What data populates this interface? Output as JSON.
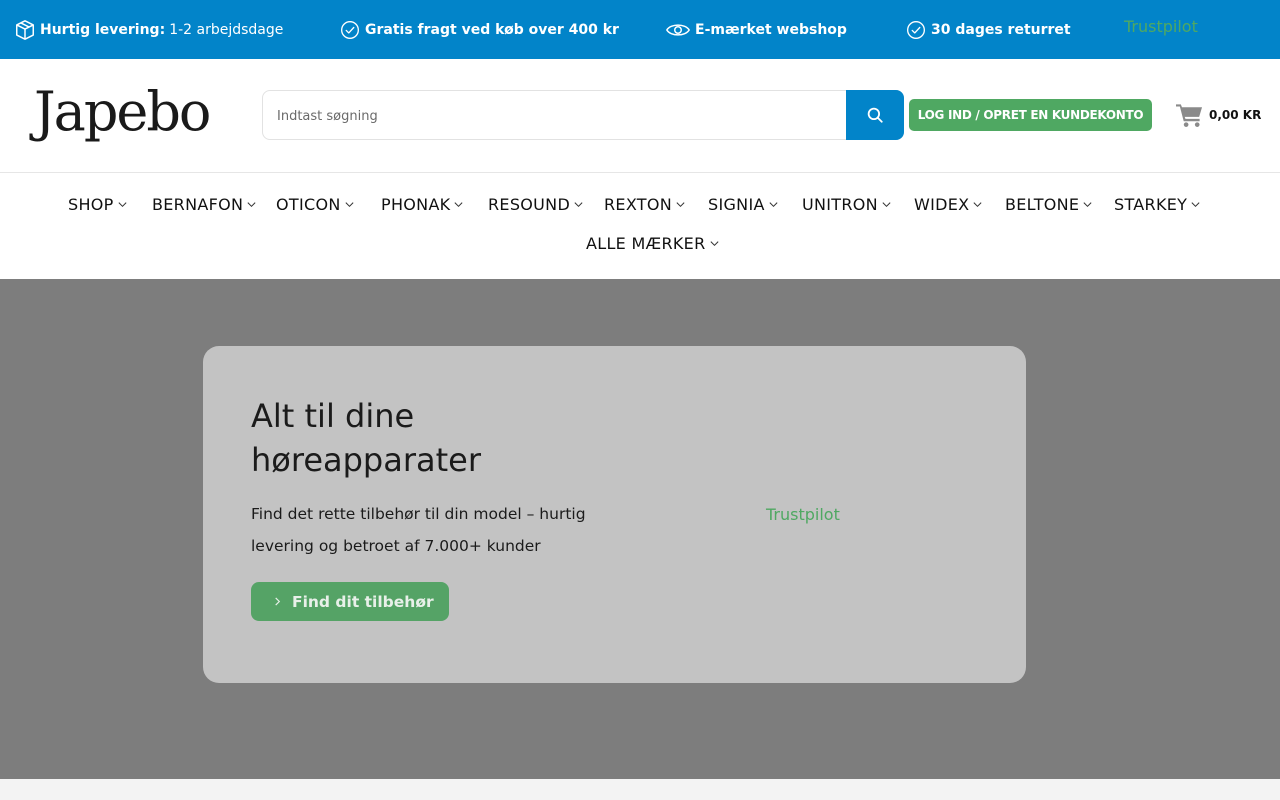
{
  "topbar": {
    "usps": [
      {
        "icon": "package-icon",
        "bold": "Hurtig levering:",
        "text": "1-2 arbejdsdage"
      },
      {
        "icon": "check-circle-icon",
        "bold": "Gratis fragt ved køb over 400 kr",
        "text": ""
      },
      {
        "icon": "eye-icon",
        "bold": "E-mærket webshop",
        "text": ""
      },
      {
        "icon": "check-circle-icon",
        "bold": "30 dages returret",
        "text": ""
      }
    ],
    "trustpilot": "Trustpilot"
  },
  "header": {
    "logo": "Japebo",
    "search": {
      "placeholder": "Indtast søgning",
      "value": ""
    },
    "login_label": "LOG IND / OPRET EN KUNDEKONTO",
    "cart_total": "0,00 KR"
  },
  "nav": {
    "items": [
      {
        "label": "SHOP"
      },
      {
        "label": "BERNAFON"
      },
      {
        "label": "OTICON"
      },
      {
        "label": "PHONAK"
      },
      {
        "label": "RESOUND"
      },
      {
        "label": "REXTON"
      },
      {
        "label": "SIGNIA"
      },
      {
        "label": "UNITRON"
      },
      {
        "label": "WIDEX"
      },
      {
        "label": "BELTONE"
      },
      {
        "label": "STARKEY"
      },
      {
        "label": "ALLE MÆRKER"
      }
    ]
  },
  "hero": {
    "title": "Alt til dine høreapparater",
    "text": "Find det rette tilbehør til din model – hurtig levering og betroet af 7.000+ kunder",
    "cta_label": "Find dit tilbehør",
    "trustpilot": "Trustpilot"
  },
  "colors": {
    "primary_blue": "#0284c9",
    "accent_green": "#4fa862",
    "hero_bg": "#7d7d7d",
    "card_bg": "#c3c3c3"
  }
}
